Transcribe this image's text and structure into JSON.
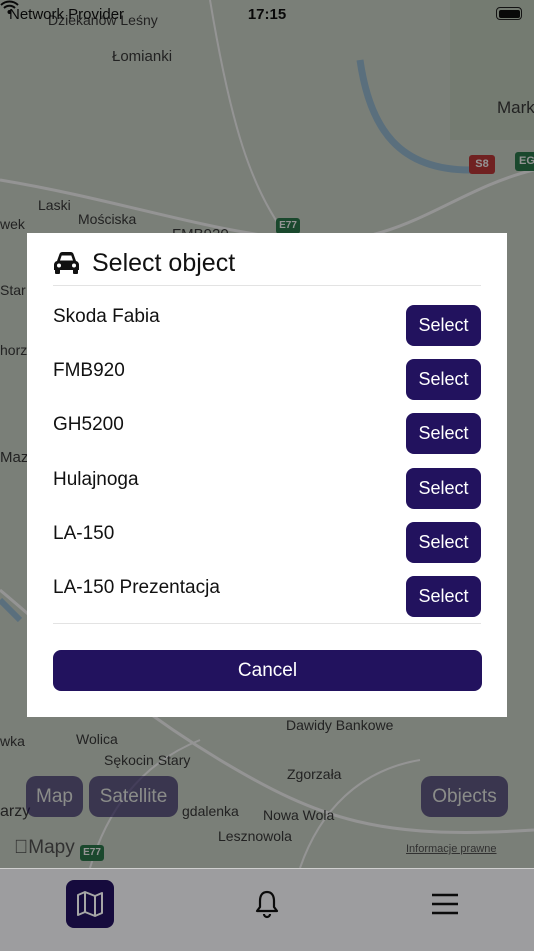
{
  "status_bar": {
    "carrier": "Network Provider",
    "time": "17:15"
  },
  "map": {
    "labels": {
      "dziekanow": "Dziekanów Leśny",
      "lomianki": "Łomianki",
      "mark": "Mark",
      "laski": "Laski",
      "wek": "wek",
      "mosciska": "Mościska",
      "fmb": "FMB920",
      "star": "Star",
      "horz": "horz",
      "maz": "Maz",
      "wka": "wka",
      "wolica": "Wolica",
      "sekocin": "Sękocin Stary",
      "dawidy": "Dawidy Bankowe",
      "zgorzala": "Zgorzała",
      "gdalenka": "gdalenka",
      "nowa_wola": "Nowa Wola",
      "lesznowola": "Lesznowola",
      "arzy": "arzy"
    },
    "road_signs": {
      "s8": "S8",
      "e77_top": "E77",
      "e77_bottom": "E77",
      "eg": "EG"
    },
    "controls": {
      "map": "Map",
      "satellite": "Satellite",
      "objects": "Objects"
    },
    "attribution": "Mapy",
    "legal": "Informacje prawne"
  },
  "dialog": {
    "title": "Select object",
    "icon": "car-icon",
    "objects": [
      {
        "name": "Skoda Fabia",
        "action": "Select"
      },
      {
        "name": "FMB920",
        "action": "Select"
      },
      {
        "name": "GH5200",
        "action": "Select"
      },
      {
        "name": "Hulajnoga",
        "action": "Select"
      },
      {
        "name": "LA-150",
        "action": "Select"
      },
      {
        "name": "LA-150 Prezentacja",
        "action": "Select"
      }
    ],
    "cancel_label": "Cancel"
  },
  "tab_bar": {
    "tabs": [
      {
        "icon": "map-icon",
        "active": true
      },
      {
        "icon": "bell-icon",
        "active": false
      },
      {
        "icon": "menu-icon",
        "active": false
      }
    ]
  },
  "colors": {
    "accent": "#22125e",
    "dialog_bg": "#ffffff",
    "tabbar_bg": "#f2f2f4"
  }
}
